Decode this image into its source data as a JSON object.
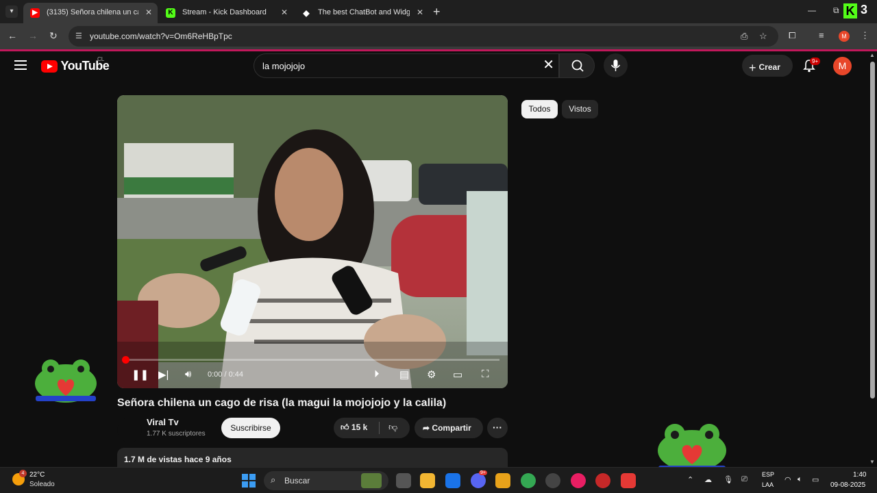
{
  "browser": {
    "tabs": [
      {
        "title": "(3135) Señora chilena un ca",
        "active": true,
        "favicon": "youtube-icon"
      },
      {
        "title": "Stream - Kick Dashboard",
        "active": false,
        "favicon": "kick-icon"
      },
      {
        "title": "The best ChatBot and Widgets",
        "active": false,
        "favicon": "diamond-icon"
      }
    ],
    "url": "youtube.com/watch?v=Om6ReHBpTpc",
    "kick_badge": "K",
    "kick_count": "3",
    "profile_initial": "M"
  },
  "youtube": {
    "logo_text": "YouTube",
    "country_code": "CL",
    "search_query": "la mojojojo",
    "create_label": "Crear",
    "notifications_badge": "9+",
    "avatar_initial": "M"
  },
  "player": {
    "current_time": "0:00",
    "duration": "0:44",
    "time_display": "0:00 / 0:44",
    "progress_fraction": 0.0
  },
  "video": {
    "title": "Señora chilena un cago de risa (la magui la mojojojo y la calila)",
    "channel_name": "Viral Tv",
    "subscribers": "1.77 K suscriptores",
    "subscribe_label": "Suscribirse",
    "likes": "15 k",
    "share_label": "Compartir",
    "views_and_date": "1.7 M de vistas  hace 9 años"
  },
  "chips": [
    {
      "label": "Todos",
      "selected": true
    },
    {
      "label": "Vistos",
      "selected": false
    }
  ],
  "taskbar": {
    "temperature": "22°C",
    "condition": "Soleado",
    "weather_badge": "4",
    "search_placeholder": "Buscar",
    "discord_badge": "9+",
    "lang_line1": "ESP",
    "lang_line2": "LAA",
    "time": "1:40",
    "date": "09-08-2025"
  }
}
